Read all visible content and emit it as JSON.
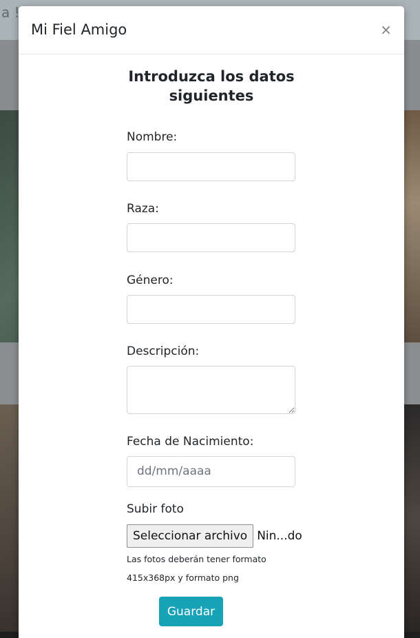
{
  "background": {
    "top_text": "a !"
  },
  "modal": {
    "title": "Mi Fiel Amigo",
    "close_glyph": "×"
  },
  "form": {
    "heading_line1": "Introduzca los datos",
    "heading_line2": "siguientes",
    "fields": {
      "nombre": {
        "label": "Nombre:",
        "value": ""
      },
      "raza": {
        "label": "Raza:",
        "value": ""
      },
      "genero": {
        "label": "Género:",
        "value": ""
      },
      "descripcion": {
        "label": "Descripción:",
        "value": ""
      },
      "fecha": {
        "label": "Fecha de Nacimiento:",
        "placeholder": "dd/mm/aaaa"
      },
      "foto": {
        "label": "Subir foto",
        "button_label": "Seleccionar archivo",
        "status": "Nin...do"
      }
    },
    "hint_line1": "Las fotos deberán tener formato",
    "hint_line2": "415x368px y formato png",
    "save_label": "Guardar"
  },
  "colors": {
    "primary_button": "#17a2b8",
    "overlay": "#6f7275"
  },
  "icons": {
    "close": "close-icon"
  }
}
